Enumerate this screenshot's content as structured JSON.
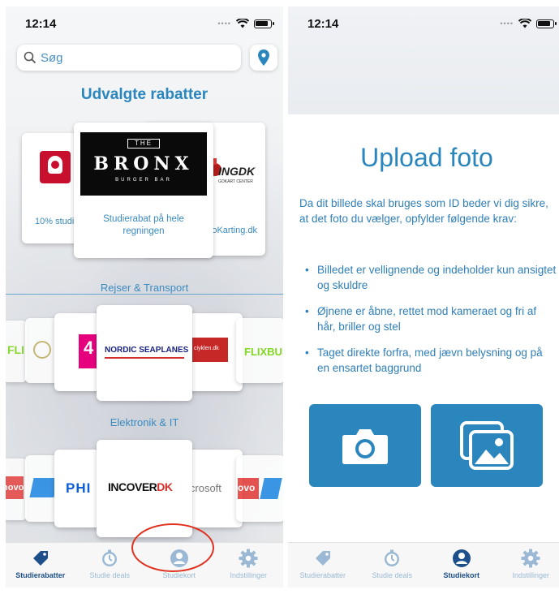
{
  "left_screen": {
    "status": {
      "time": "12:14"
    },
    "search": {
      "placeholder": "Søg"
    },
    "sections": {
      "featured": "Udvalgte rabatter",
      "travel": "Rejser & Transport",
      "electronics": "Elektronik & IT"
    },
    "featured_cards": {
      "center_logo_line1": "THE",
      "center_logo_line2": "BRONX",
      "center_logo_line3": "BURGER BAR",
      "center_caption": "Studierabat på hele regningen",
      "left_caption": "10% studi",
      "right_logo": "INGDK",
      "right_logo_sub": "GOKART CENTER",
      "right_caption": "oKarting.dk"
    },
    "travel_cards": {
      "far_left": "FLI",
      "left2": "4",
      "center": "NORDIC SEAPLANES",
      "right_logo": "ciyklen.dk",
      "far_right": "FLIXBUS"
    },
    "electronics_cards": {
      "far_left": "novo",
      "left2": "PHI",
      "center_prefix": "INCOVER",
      "center_suffix": "DK",
      "right": "icrosoft",
      "far_right": "ovo"
    },
    "tabs": [
      {
        "label": "Studierabatter",
        "icon": "tag-icon",
        "active": true
      },
      {
        "label": "Studie deals",
        "icon": "stopwatch-icon",
        "active": false
      },
      {
        "label": "Studiekort",
        "icon": "user-icon",
        "active": false
      },
      {
        "label": "Indstillinger",
        "icon": "gear-icon",
        "active": false
      }
    ]
  },
  "right_screen": {
    "status": {
      "time": "12:14"
    },
    "title": "Upload foto",
    "description": "Da dit billede skal bruges som ID beder vi dig sikre, at det foto du vælger, opfylder følgende krav:",
    "requirements": [
      "Billedet er vellignende og indeholder kun ansigtet og skuldre",
      "Øjnene er åbne, rettet mod kameraet og fri af hår, briller og stel",
      "Taget direkte forfra, med jævn belysning og på en ensartet baggrund"
    ],
    "buttons": {
      "camera": "camera-icon",
      "gallery": "gallery-icon"
    },
    "tabs": [
      {
        "label": "Studierabatter",
        "icon": "tag-icon",
        "active": false
      },
      {
        "label": "Studie deals",
        "icon": "stopwatch-icon",
        "active": false
      },
      {
        "label": "Studiekort",
        "icon": "user-icon",
        "active": true
      },
      {
        "label": "Indstillinger",
        "icon": "gear-icon",
        "active": false
      }
    ]
  },
  "colors": {
    "accent": "#2a86bd",
    "tab_active": "#1d4f8a",
    "tab_inactive": "#9bb9d4",
    "annotation_red": "#e0301e"
  }
}
